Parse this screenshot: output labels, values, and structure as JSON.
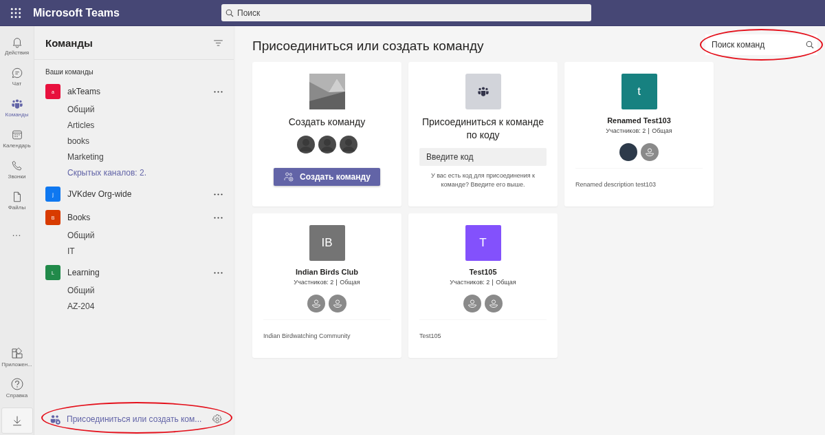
{
  "app_title": "Microsoft Teams",
  "search": {
    "placeholder": "Поиск"
  },
  "rail": [
    {
      "label": "Действия",
      "kind": "bell",
      "selected": false
    },
    {
      "label": "Чат",
      "kind": "chat",
      "selected": false
    },
    {
      "label": "Команды",
      "kind": "teams",
      "selected": true
    },
    {
      "label": "Календарь",
      "kind": "calendar",
      "selected": false
    },
    {
      "label": "Звонки",
      "kind": "phone",
      "selected": false
    },
    {
      "label": "Файлы",
      "kind": "file",
      "selected": false
    },
    {
      "label": "…",
      "kind": "more",
      "selected": false
    }
  ],
  "rail_bottom": [
    {
      "label": "Приложен...",
      "kind": "apps"
    },
    {
      "label": "Справка",
      "kind": "help"
    }
  ],
  "sidebar": {
    "title": "Команды",
    "section": "Ваши команды",
    "teams": [
      {
        "name": "akTeams",
        "initial": "a",
        "color": "#e8103d",
        "channels": [
          "Общий",
          "Articles",
          "books",
          "Marketing"
        ],
        "hidden_channels": "Скрытых каналов: 2."
      },
      {
        "name": "JVKdev Org-wide",
        "initial": "j",
        "color": "#0f78f0"
      },
      {
        "name": "Books",
        "initial": "B",
        "color": "#d83b01",
        "channels": [
          "Общий",
          "IT"
        ]
      },
      {
        "name": "Learning",
        "initial": "L",
        "color": "#218a4a",
        "channels": [
          "Общий",
          "AZ-204"
        ]
      }
    ],
    "footer": {
      "label": "Присоединиться или создать ком...",
      "highlighted": true
    }
  },
  "main": {
    "title": "Присоединиться или создать команду",
    "team_search": {
      "placeholder": "Поиск команд",
      "highlighted": true
    },
    "cards": [
      {
        "kind": "create",
        "title": "Создать команду",
        "button": "Создать команду"
      },
      {
        "kind": "join",
        "title": "Присоединиться к команде по коду",
        "placeholder": "Введите код",
        "hint": "У вас есть код для присоединения к команде? Введите его выше."
      },
      {
        "kind": "team",
        "initial": "t",
        "color": "#178180",
        "name": "Renamed Test103",
        "members": "Участников: 2",
        "privacy": "Общая",
        "avatars": [
          {
            "kind": "photo"
          },
          {
            "kind": "placeholder"
          }
        ],
        "description": "Renamed description test103"
      },
      {
        "kind": "team",
        "initial": "IB",
        "color": "#747474",
        "name": "Indian Birds Club",
        "members": "Участников: 2",
        "privacy": "Общая",
        "avatars": [
          {
            "kind": "placeholder"
          },
          {
            "kind": "placeholder"
          }
        ],
        "description": "Indian Birdwatching Community"
      },
      {
        "kind": "team",
        "initial": "T",
        "color": "#8351fc",
        "name": "Test105",
        "members": "Участников: 2",
        "privacy": "Общая",
        "avatars": [
          {
            "kind": "placeholder"
          },
          {
            "kind": "placeholder"
          }
        ],
        "description": "Test105"
      }
    ]
  }
}
